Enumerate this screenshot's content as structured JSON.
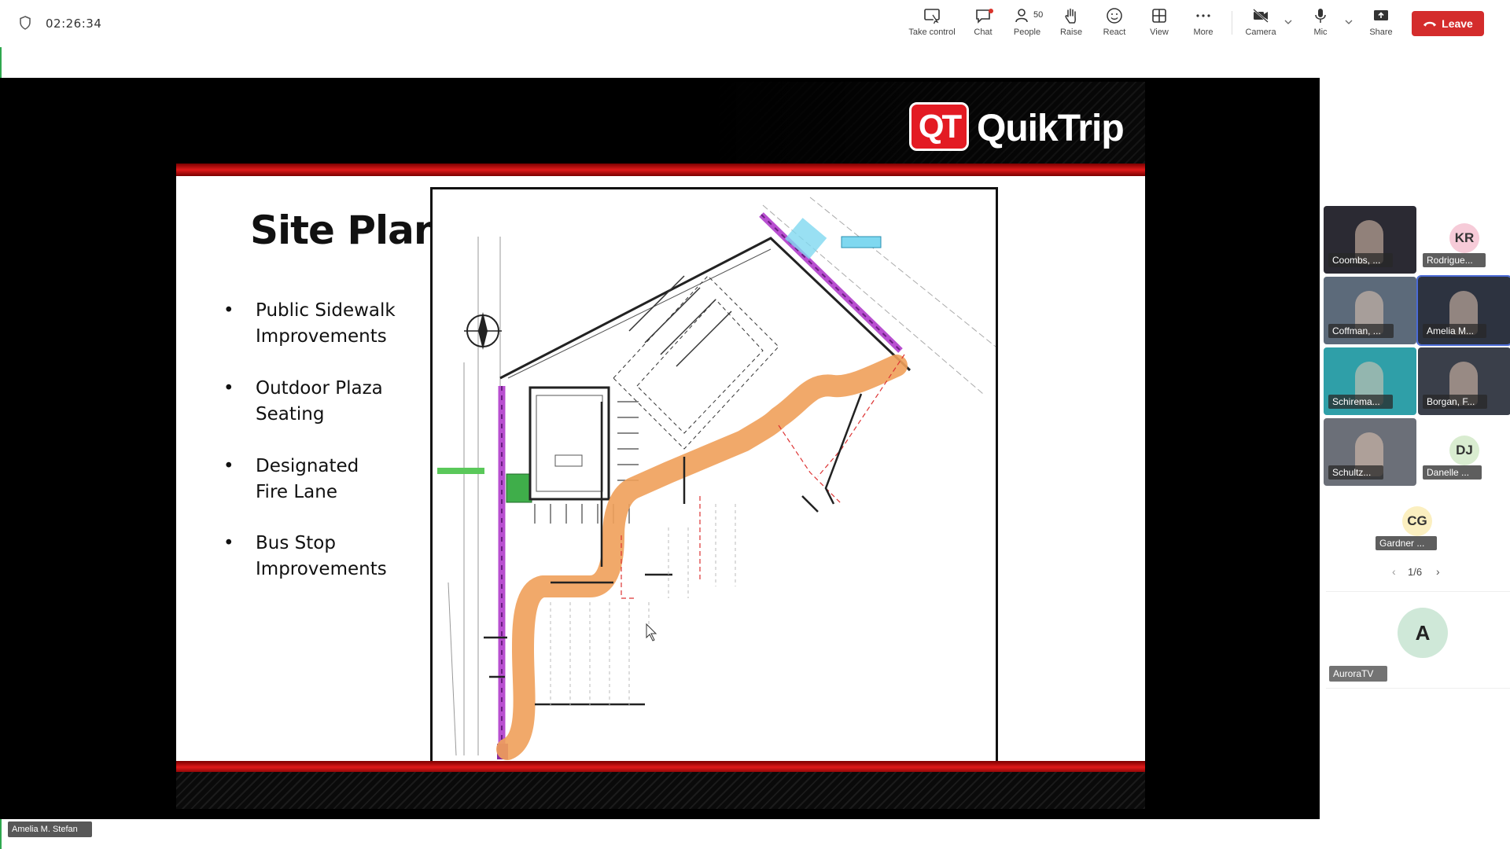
{
  "timer": "02:26:34",
  "toolbar": {
    "take_control": "Take control",
    "chat": "Chat",
    "people": "People",
    "people_count": "50",
    "raise": "Raise",
    "react": "React",
    "view": "View",
    "more": "More",
    "camera": "Camera",
    "mic": "Mic",
    "share": "Share",
    "leave": "Leave"
  },
  "colors": {
    "leave": "#d42c2c",
    "fire_lane": "#f0a05a",
    "sidewalk": "#b84fd0",
    "qt_red": "#e31b23"
  },
  "slide": {
    "brand_badge": "QT",
    "brand_name": "QuikTrip",
    "title": "Site Plan",
    "bullets": [
      "Public Sidewalk Improvements",
      "Outdoor Plaza Seating",
      "Designated Fire Lane",
      "Bus Stop Improvements"
    ]
  },
  "participants": [
    {
      "name": "Coombs, ...",
      "type": "video"
    },
    {
      "name": "Rodrigue...",
      "type": "avatar",
      "initials": "KR",
      "color": "#f6cbd8"
    },
    {
      "name": "Coffman, ...",
      "type": "video"
    },
    {
      "name": "Amelia M...",
      "type": "video"
    },
    {
      "name": "Schirema...",
      "type": "video"
    },
    {
      "name": "Borgan, F...",
      "type": "video"
    },
    {
      "name": "Schultz...",
      "type": "video"
    },
    {
      "name": "Danelle ...",
      "type": "avatar",
      "initials": "DJ",
      "color": "#d9ecd0"
    },
    {
      "name": "Gardner ...",
      "type": "avatar",
      "initials": "CG",
      "color": "#fbefc0"
    }
  ],
  "pager": "1/6",
  "aurora": {
    "name": "AuroraTV",
    "initial": "A"
  },
  "speaker": "Amelia M. Stefan"
}
